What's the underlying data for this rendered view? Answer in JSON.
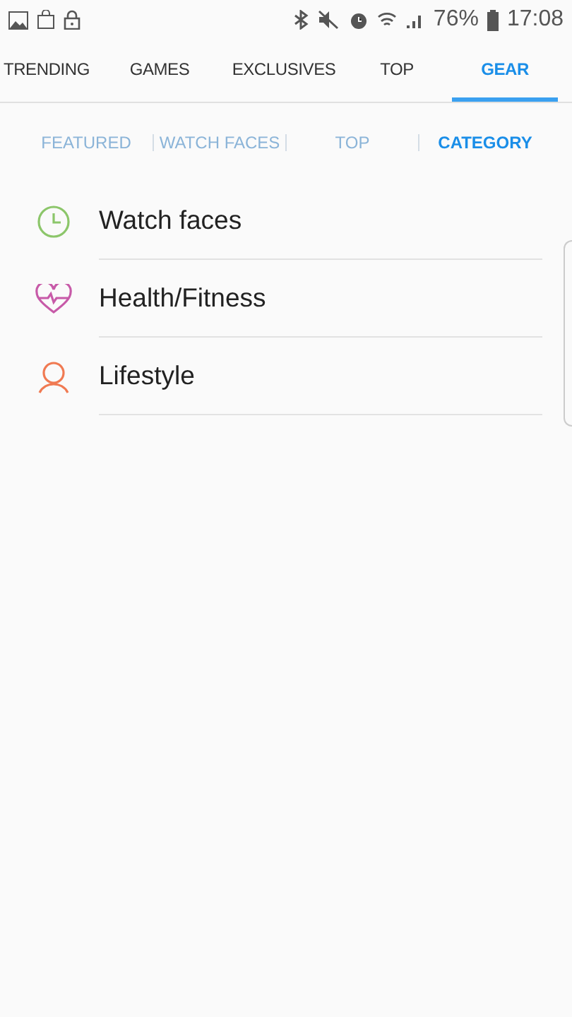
{
  "status_bar": {
    "battery": "76%",
    "time": "17:08"
  },
  "tabs": [
    {
      "label": "TRENDING",
      "selected": false
    },
    {
      "label": "GAMES",
      "selected": false
    },
    {
      "label": "EXCLUSIVES",
      "selected": false
    },
    {
      "label": "TOP",
      "selected": false
    },
    {
      "label": "GEAR",
      "selected": true
    }
  ],
  "subtabs": [
    {
      "label": "FEATURED",
      "selected": false
    },
    {
      "label": "WATCH FACES",
      "selected": false
    },
    {
      "label": "TOP",
      "selected": false
    },
    {
      "label": "CATEGORY",
      "selected": true
    }
  ],
  "categories": [
    {
      "label": "Watch faces",
      "kind": "clock",
      "color": "#8cc66a"
    },
    {
      "label": "Health/Fitness",
      "kind": "heart",
      "color": "#c75aa8"
    },
    {
      "label": "Lifestyle",
      "kind": "person",
      "color": "#f07a52"
    }
  ]
}
